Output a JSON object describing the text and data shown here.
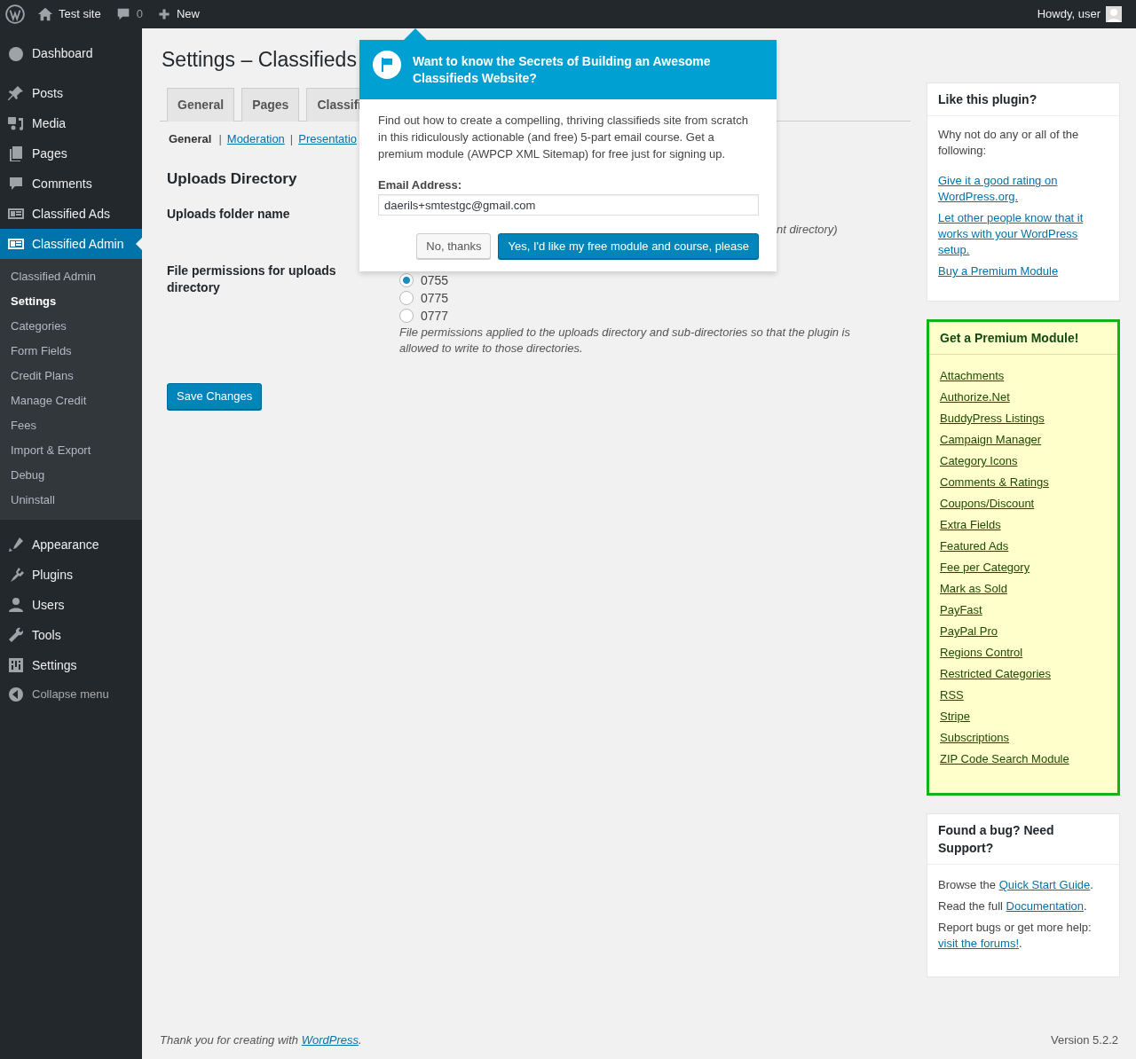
{
  "admin_bar": {
    "site": "Test site",
    "comments": "0",
    "new": "New",
    "greeting": "Howdy, user"
  },
  "menu": {
    "groups": [
      [
        {
          "label": "Dashboard",
          "selected": false
        }
      ],
      [
        {
          "label": "Posts",
          "selected": false
        },
        {
          "label": "Media",
          "selected": false
        },
        {
          "label": "Pages",
          "selected": false
        },
        {
          "label": "Comments",
          "selected": false
        },
        {
          "label": "Classified Ads",
          "selected": false
        },
        {
          "label": "Classified Admin",
          "selected": true,
          "children": [
            {
              "label": "Classified Admin",
              "selected": false
            },
            {
              "label": "Settings",
              "selected": true
            },
            {
              "label": "Categories",
              "selected": false
            },
            {
              "label": "Form Fields",
              "selected": false
            },
            {
              "label": "Credit Plans",
              "selected": false
            },
            {
              "label": "Manage Credit",
              "selected": false
            },
            {
              "label": "Fees",
              "selected": false
            },
            {
              "label": "Import & Export",
              "selected": false
            },
            {
              "label": "Debug",
              "selected": false
            },
            {
              "label": "Uninstall",
              "selected": false
            }
          ]
        }
      ],
      [
        {
          "label": "Appearance",
          "selected": false
        },
        {
          "label": "Plugins",
          "selected": false
        },
        {
          "label": "Users",
          "selected": false
        },
        {
          "label": "Tools",
          "selected": false
        },
        {
          "label": "Settings",
          "selected": false
        }
      ]
    ],
    "collapse": "Collapse menu"
  },
  "page": {
    "title": "Settings – Classifieds",
    "tabs": [
      {
        "label": "General"
      },
      {
        "label": "Pages"
      },
      {
        "label": "Classifi"
      }
    ],
    "subnav": [
      {
        "label": "General",
        "selected": true
      },
      {
        "separator": "|",
        "label": "Moderation",
        "selected": false
      },
      {
        "separator": "|",
        "label": "Presentatio",
        "selected": false
      }
    ],
    "section": "Uploads Directory",
    "fields": [
      {
        "label": "Uploads folder name",
        "description": "nt directory)"
      },
      {
        "label": "File permissions for uploads directory",
        "options": [
          {
            "label": "0755",
            "selected": true
          },
          {
            "label": "0775",
            "selected": false
          },
          {
            "label": "0777",
            "selected": false
          }
        ],
        "description": "File permissions applied to the uploads directory and sub-directories so that the plugin is allowed to write to those directories."
      }
    ],
    "save": "Save Changes"
  },
  "popup": {
    "title": "Want to know the Secrets of Building an Awesome Classifieds Website?",
    "body": "Find out how to create a compelling, thriving classifieds site from scratch in this ridiculously actionable (and free) 5-part email course. Get a premium module (AWPCP XML Sitemap) for free just for signing up.",
    "email_label": "Email Address:",
    "email_value": "daerils+smtestgc@gmail.com",
    "decline": "No, thanks",
    "accept": "Yes, I'd like my free module and course, please"
  },
  "boxes": {
    "like": {
      "title": "Like this plugin?",
      "intro": "Why not do any or all of the following:",
      "links": [
        "Give it a good rating on WordPress.org.",
        "Let other people know that it works with your WordPress setup.",
        "Buy a Premium Module"
      ]
    },
    "premium": {
      "title": "Get a Premium Module!",
      "links": [
        "Attachments",
        "Authorize.Net",
        "BuddyPress Listings",
        "Campaign Manager",
        "Category Icons",
        "Comments & Ratings",
        "Coupons/Discount",
        "Extra Fields",
        "Featured Ads",
        "Fee per Category",
        "Mark as Sold",
        "PayFast",
        "PayPal Pro",
        "Regions Control",
        "Restricted Categories",
        "RSS",
        "Stripe",
        "Subscriptions",
        "ZIP Code Search Module"
      ]
    },
    "support": {
      "title": "Found a bug? Need Support?",
      "lines": [
        {
          "before": "Browse the ",
          "link": "Quick Start Guide",
          "after": "."
        },
        {
          "before": "Read the full ",
          "link": "Documentation",
          "after": "."
        },
        {
          "before": "Report bugs or get more help:",
          "link": "visit the forums!",
          "after": "."
        }
      ]
    }
  },
  "footer": {
    "before": "Thank you for creating with ",
    "link": "WordPress",
    "after": ".",
    "version": "Version 5.2.2"
  }
}
